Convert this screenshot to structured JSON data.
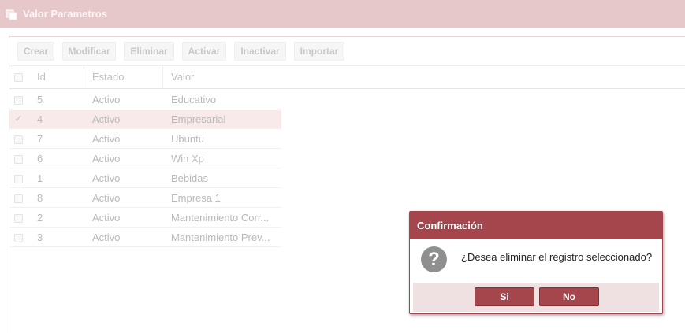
{
  "window": {
    "title": "Valor Parametros",
    "title_icon": "window-stack-icon"
  },
  "toolbar": {
    "buttons": [
      "Crear",
      "Modificar",
      "Eliminar",
      "Activar",
      "Inactivar",
      "Importar"
    ]
  },
  "grid": {
    "columns": [
      "Id",
      "Estado",
      "Valor"
    ],
    "rows": [
      {
        "id": "5",
        "estado": "Activo",
        "valor": "Educativo",
        "checked": false
      },
      {
        "id": "4",
        "estado": "Activo",
        "valor": "Empresarial",
        "checked": true
      },
      {
        "id": "7",
        "estado": "Activo",
        "valor": "Ubuntu",
        "checked": false
      },
      {
        "id": "6",
        "estado": "Activo",
        "valor": "Win Xp",
        "checked": false
      },
      {
        "id": "1",
        "estado": "Activo",
        "valor": "Bebidas",
        "checked": false
      },
      {
        "id": "8",
        "estado": "Activo",
        "valor": "Empresa 1",
        "checked": false
      },
      {
        "id": "2",
        "estado": "Activo",
        "valor": "Mantenimiento Corr...",
        "checked": false
      },
      {
        "id": "3",
        "estado": "Activo",
        "valor": "Mantenimiento Prev...",
        "checked": false
      }
    ],
    "check_glyph": "✓"
  },
  "dialog": {
    "title": "Confirmación",
    "icon": "question-icon",
    "icon_glyph": "?",
    "message": "¿Desea eliminar el registro seleccionado?",
    "yes_label": "Si",
    "no_label": "No"
  },
  "colors": {
    "title_bar": "#e7c8ca",
    "dialog_header": "#a5464c",
    "selected_row": "#f8eaeb"
  }
}
